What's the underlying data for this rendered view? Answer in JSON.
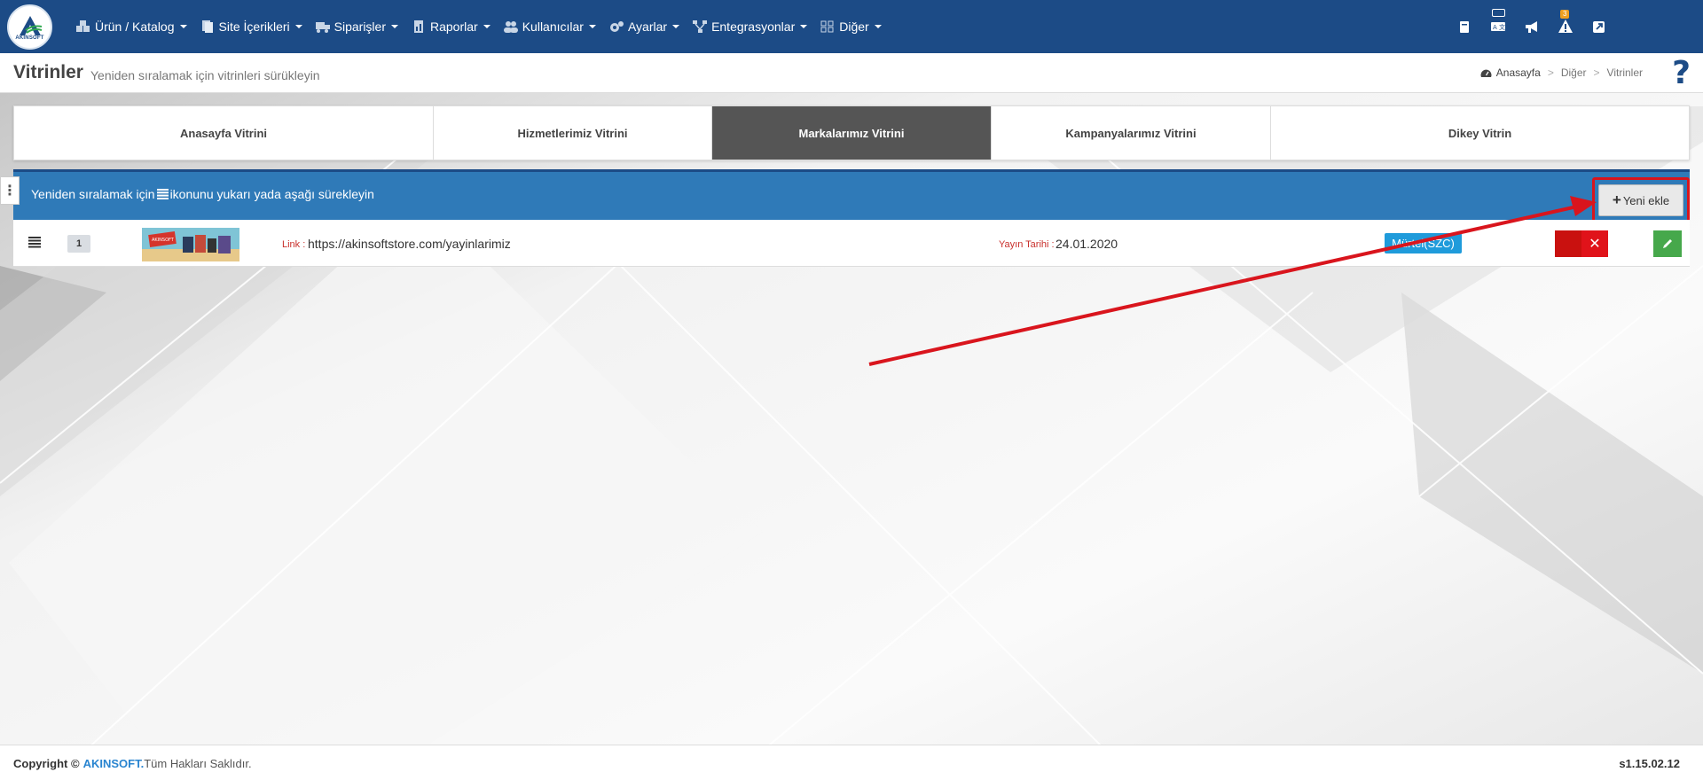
{
  "logo": {
    "text": "AKINSOFT"
  },
  "nav": {
    "items": [
      {
        "label": "Ürün / Katalog",
        "icon": "boxes-icon"
      },
      {
        "label": "Site İçerikleri",
        "icon": "documents-icon"
      },
      {
        "label": "Siparişler",
        "icon": "truck-icon"
      },
      {
        "label": "Raporlar",
        "icon": "report-icon"
      },
      {
        "label": "Kullanıcılar",
        "icon": "users-icon"
      },
      {
        "label": "Ayarlar",
        "icon": "gears-icon"
      },
      {
        "label": "Entegrasyonlar",
        "icon": "network-icon"
      },
      {
        "label": "Diğer",
        "icon": "grid-icon"
      }
    ],
    "right_icons": [
      "book-icon",
      "translate-icon",
      "megaphone-icon",
      "warning-icon",
      "external-link-icon"
    ],
    "warning_count": "3"
  },
  "header": {
    "title": "Vitrinler",
    "subtitle": "Yeniden sıralamak için vitrinleri sürükleyin",
    "breadcrumb": [
      "Anasayfa",
      "Diğer",
      "Vitrinler"
    ],
    "help": "?"
  },
  "tabs": [
    {
      "label": "Anasayfa Vitrini",
      "active": false
    },
    {
      "label": "Hizmetlerimiz Vitrini",
      "active": false
    },
    {
      "label": "Markalarımız Vitrini",
      "active": true
    },
    {
      "label": "Kampanyalarımız Vitrini",
      "active": false
    },
    {
      "label": "Dikey Vitrin",
      "active": false
    }
  ],
  "panel": {
    "instruction_before": "Yeniden sıralamak için",
    "instruction_after": "ikonunu yukarı yada aşağı sürekleyin",
    "add_button": "Yeni ekle"
  },
  "rows": [
    {
      "order": "1",
      "thumb_text": "AKINSOFT",
      "link_label": "Link :",
      "link": "https://akinsoftstore.com/yayinlarimiz",
      "date_label": "Yayın Tarihi :",
      "date": "24.01.2020",
      "status": "Mürtel(SZC)"
    }
  ],
  "footer": {
    "copyright": "Copyright ©",
    "brand": "AKINSOFT.",
    "rights": "Tüm Hakları Saklıdır.",
    "version": "s1.15.02.12"
  },
  "colors": {
    "navbar": "#1c4b86",
    "panel_head": "#2f7ab8",
    "active_tab": "#555555",
    "delete": "#e0131a",
    "edit": "#46a84b",
    "status": "#1f9bdb",
    "annotation": "#d9151d"
  }
}
